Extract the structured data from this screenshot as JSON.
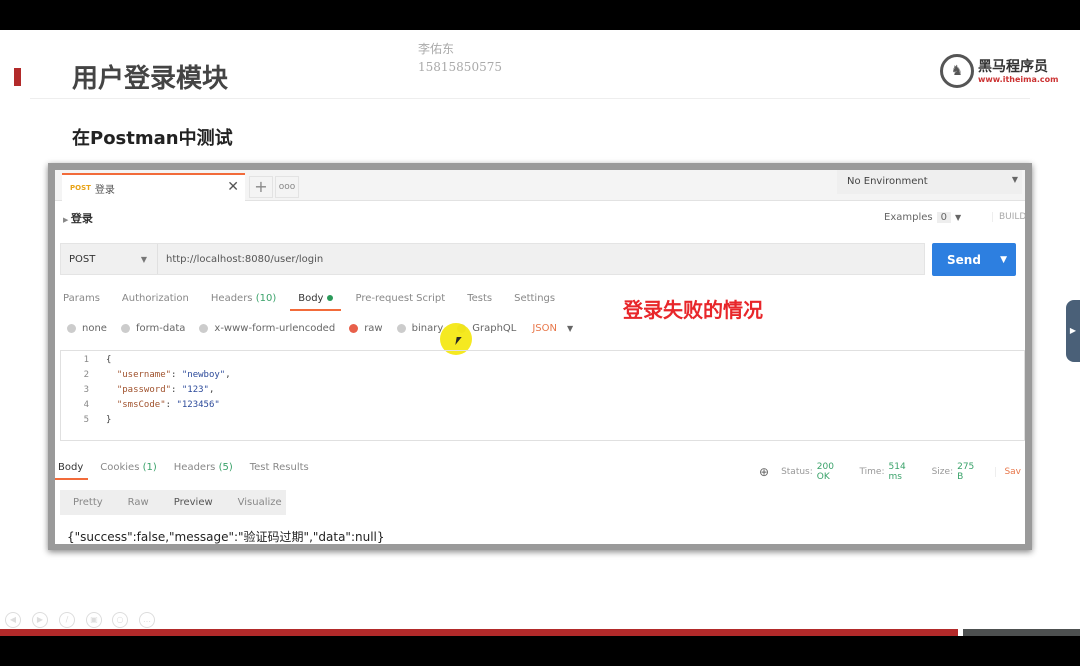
{
  "slide": {
    "title": "用户登录模块",
    "subtitle": "在Postman中测试",
    "watermark_name": "李佑东",
    "watermark_phone": "15815850575",
    "logo_text": "黑马程序员",
    "logo_url": "www.itheima.com",
    "annotation": "登录失败的情况"
  },
  "postman": {
    "tab": {
      "method": "POST",
      "name": "登录"
    },
    "environment": "No Environment",
    "request_name": "登录",
    "examples_label": "Examples",
    "examples_count": "0",
    "build_label": "BUILD",
    "method": "POST",
    "url": "http://localhost:8080/user/login",
    "send_label": "Send",
    "request_tabs": [
      "Params",
      "Authorization",
      "Headers",
      "(10)",
      "Body",
      "Pre-request Script",
      "Tests",
      "Settings"
    ],
    "body_types": [
      "none",
      "form-data",
      "x-www-form-urlencoded",
      "raw",
      "binary",
      "GraphQL"
    ],
    "body_format": "JSON",
    "code_lines": [
      {
        "n": "1",
        "text": "{"
      },
      {
        "n": "2",
        "key": "\"username\"",
        "val": "\"newboy\"",
        "tail": ","
      },
      {
        "n": "3",
        "key": "\"password\"",
        "val": "\"123\"",
        "tail": ","
      },
      {
        "n": "4",
        "key": "\"smsCode\"",
        "val": "\"123456\"",
        "tail": ""
      },
      {
        "n": "5",
        "text": "}"
      }
    ],
    "response_tabs": {
      "body": "Body",
      "cookies": "Cookies",
      "cookies_count": "(1)",
      "headers": "Headers",
      "headers_count": "(5)",
      "tests": "Test Results"
    },
    "status": {
      "status_label": "Status:",
      "status": "200 OK",
      "time_label": "Time:",
      "time": "514 ms",
      "size_label": "Size:",
      "size": "275 B",
      "save": "Sav"
    },
    "views": [
      "Pretty",
      "Raw",
      "Preview",
      "Visualize"
    ],
    "response": "{\"success\":false,\"message\":\"验证码过期\",\"data\":null}"
  },
  "colors": {
    "accent": "#f26b3a",
    "send": "#2d7fe0",
    "annotation": "#e8262a",
    "slide_bar": "#b22a2a"
  }
}
